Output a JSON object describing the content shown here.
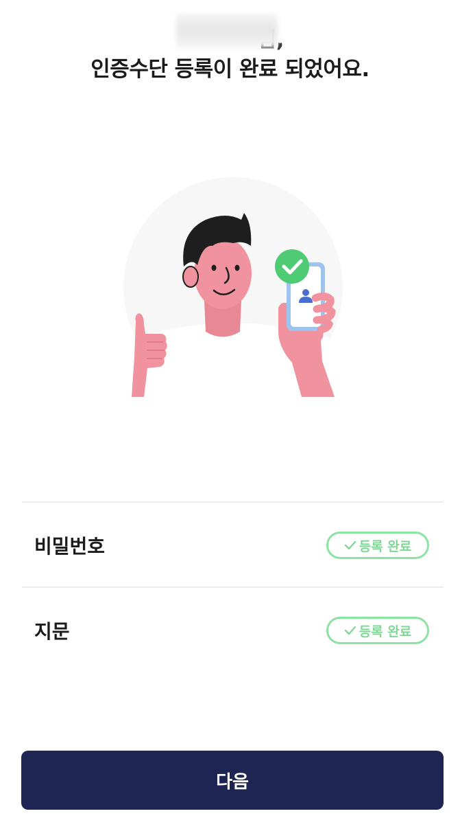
{
  "header": {
    "greeting_suffix": "님,",
    "title": "인증수단 등록이 완료 되었어요."
  },
  "illustration": {
    "icon": "person-thumbs-up-phone-check-illustration",
    "colors": {
      "background_circle": "#f7f7f7",
      "skin": "#f0939e",
      "hair": "#1e1e1e",
      "check_badge": "#4ecb73",
      "phone_frame": "#9cc4ee"
    }
  },
  "auth_methods": [
    {
      "label": "비밀번호",
      "status": "등록 완료"
    },
    {
      "label": "지문",
      "status": "등록 완료"
    }
  ],
  "colors": {
    "badge": "#8be3a3",
    "badge_text": "#7fd796",
    "primary_button": "#1f2552"
  },
  "footer": {
    "next_label": "다음"
  }
}
